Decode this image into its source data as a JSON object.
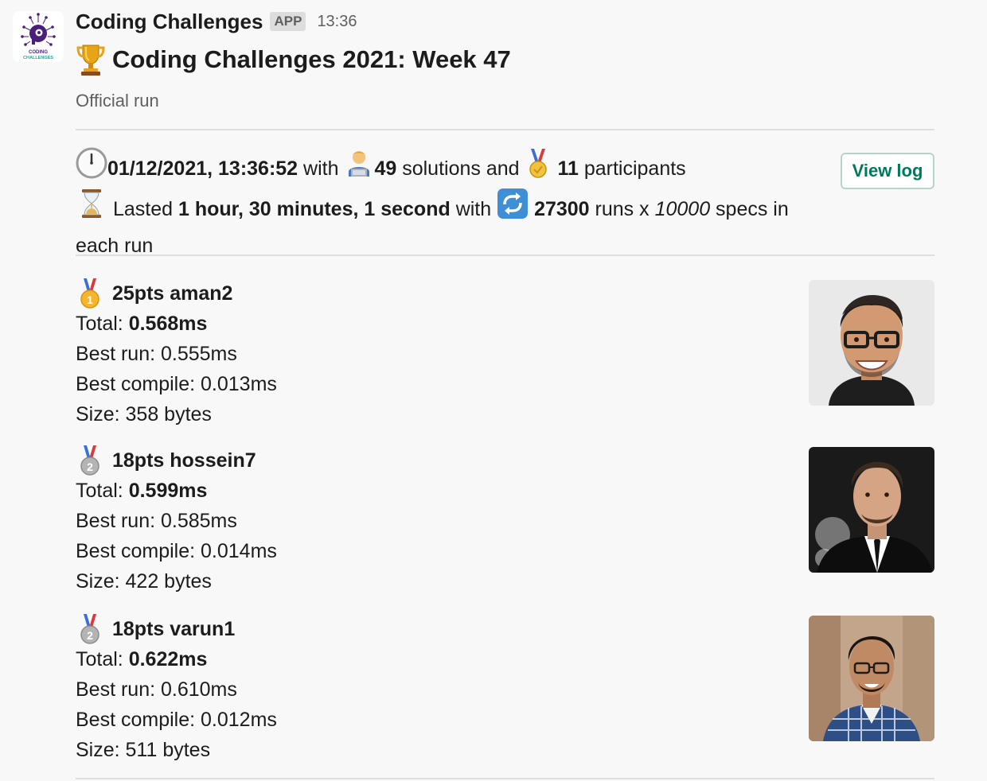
{
  "header": {
    "app_name": "Coding Challenges",
    "badge": "APP",
    "time": "13:36",
    "logo_text_1": "CODING",
    "logo_text_2": "CHALLENGES"
  },
  "title": {
    "icon": "trophy-icon",
    "text": "Coding Challenges 2021: Week 47"
  },
  "subtitle": "Official run",
  "stats": {
    "datetime": "01/12/2021, 13:36:52",
    "with_1": " with ",
    "solutions_count": "49",
    "solutions_label": " solutions and ",
    "participants_count": "11",
    "participants_label": " participants",
    "lasted_label": "Lasted ",
    "duration": "1 hour, 30 minutes, 1 second",
    "with_2": " with ",
    "runs_count": "27300",
    "runs_label": " runs x ",
    "specs_count": "10000",
    "specs_label": " specs in each run"
  },
  "view_log_label": "View log",
  "entries": [
    {
      "medal": "gold-medal-icon",
      "headline": "25pts aman2",
      "total_label": "Total: ",
      "total": "0.568ms",
      "best_run": "Best run: 0.555ms",
      "best_compile": "Best compile: 0.013ms",
      "size": "Size: 358 bytes"
    },
    {
      "medal": "silver-medal-icon",
      "headline": "18pts hossein7",
      "total_label": "Total: ",
      "total": "0.599ms",
      "best_run": "Best run: 0.585ms",
      "best_compile": "Best compile: 0.014ms",
      "size": "Size: 422 bytes"
    },
    {
      "medal": "silver-medal-icon",
      "headline": "18pts varun1",
      "total_label": "Total: ",
      "total": "0.622ms",
      "best_run": "Best run: 0.610ms",
      "best_compile": "Best compile: 0.012ms",
      "size": "Size: 511 bytes"
    }
  ],
  "colors": {
    "background": "#f8f8f8",
    "button_text": "#007a5a",
    "muted_text": "#616061",
    "logo_purple": "#4a1e7c"
  }
}
